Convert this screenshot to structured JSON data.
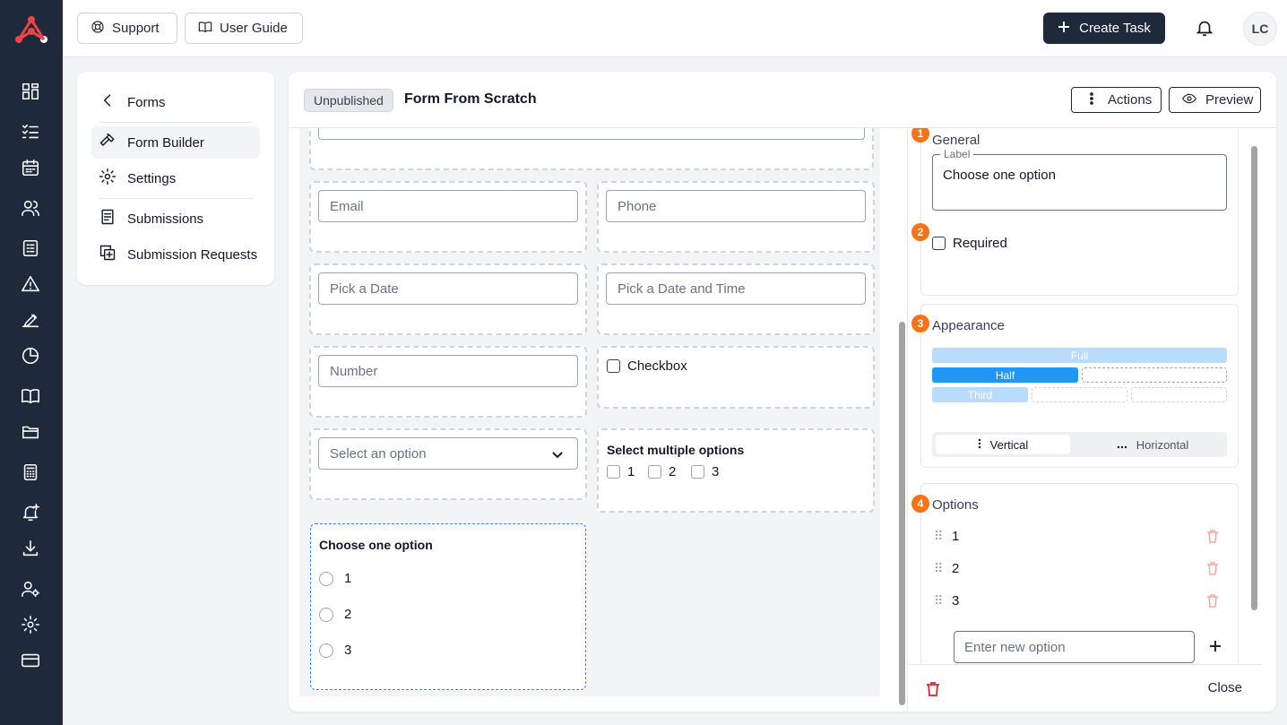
{
  "topbar": {
    "support_label": "Support",
    "user_guide_label": "User Guide",
    "create_task_label": "Create Task",
    "avatar_initials": "LC"
  },
  "nav": {
    "back_label": "Forms",
    "items": [
      {
        "label": "Form Builder",
        "icon": "hammer-icon",
        "active": true
      },
      {
        "label": "Settings",
        "icon": "gear-icon",
        "active": false
      },
      {
        "label": "Submissions",
        "icon": "document-icon",
        "active": false
      },
      {
        "label": "Submission Requests",
        "icon": "copy-plus-icon",
        "active": false
      }
    ]
  },
  "form": {
    "status": "Unpublished",
    "title": "Form From Scratch",
    "actions_label": "Actions",
    "preview_label": "Preview"
  },
  "canvas": {
    "email_placeholder": "Email",
    "phone_placeholder": "Phone",
    "date_placeholder": "Pick a Date",
    "datetime_placeholder": "Pick a Date and Time",
    "number_placeholder": "Number",
    "checkbox_label": "Checkbox",
    "select_placeholder": "Select an option",
    "multi_label": "Select multiple options",
    "multi_options": [
      "1",
      "2",
      "3"
    ],
    "radio_label": "Choose one option",
    "radio_options": [
      "1",
      "2",
      "3"
    ]
  },
  "properties": {
    "general": {
      "step": "1",
      "title": "General",
      "label_legend": "Label",
      "label_value": "Choose one option"
    },
    "required": {
      "step": "2",
      "label": "Required"
    },
    "appearance": {
      "step": "3",
      "title": "Appearance",
      "width_full": "Full",
      "width_half": "Half",
      "width_third": "Third",
      "selected_width": "Half",
      "orientation_vertical": "Vertical",
      "orientation_horizontal": "Horizontal",
      "selected_orientation": "Vertical"
    },
    "options": {
      "step": "4",
      "title": "Options",
      "items": [
        "1",
        "2",
        "3"
      ],
      "new_option_placeholder": "Enter new option"
    },
    "close_label": "Close"
  },
  "colors": {
    "rail": "#1e293b",
    "accent": "#2196f3",
    "step_badge": "#f97316",
    "danger": "#dc2626"
  }
}
